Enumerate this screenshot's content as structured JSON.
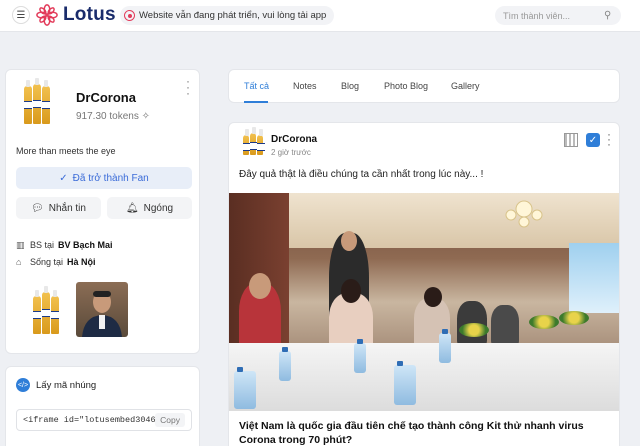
{
  "app": {
    "logo_text": "Lotus",
    "notice": "Website vẫn đang phát triển, vui lòng tải app",
    "search_placeholder": "Tìm thành viên..."
  },
  "profile": {
    "name": "DrCorona",
    "tokens": "917.30 tokens",
    "bio": "More than meets the eye",
    "fan_button": "Đã trở thành Fan",
    "message_button": "Nhắn tin",
    "mute_button": "Ngóng",
    "work_prefix": "BS tại",
    "work_place": "BV Bạch Mai",
    "live_prefix": "Sống tại",
    "live_place": "Hà Nội"
  },
  "embed": {
    "title": "Lấy mã nhúng",
    "code": "<iframe id=\"lotusembed30468",
    "copy_label": "Copy"
  },
  "tabs": [
    {
      "label": "Tất cả",
      "active": true
    },
    {
      "label": "Notes",
      "active": false
    },
    {
      "label": "Blog",
      "active": false
    },
    {
      "label": "Photo Blog",
      "active": false
    },
    {
      "label": "Gallery",
      "active": false
    }
  ],
  "post": {
    "author": "DrCorona",
    "time": "2 giờ trước",
    "text": "Đây quả thật là điều chúng ta cần nhất trong lúc này... !",
    "headline": "Việt Nam là quốc gia đầu tiên chế tạo thành công Kit thử nhanh virus Corona trong 70 phút?"
  },
  "colors": {
    "brand": "#1a2c6b",
    "accent": "#2f7ed8",
    "logo_pink": "#e23b5a",
    "background": "#eef0f4"
  },
  "icons": {
    "menu": "hamburger-icon",
    "logo": "lotus-flower-icon",
    "notice": "record-dot-icon",
    "search": "search-icon",
    "fan": "checkmark-icon",
    "message": "chat-bubble-icon",
    "mute": "bell-icon",
    "work": "building-icon",
    "home": "home-icon",
    "embed": "code-icon",
    "qr": "qr-code-icon",
    "verified": "check-square-icon",
    "more": "vertical-dots-icon"
  }
}
